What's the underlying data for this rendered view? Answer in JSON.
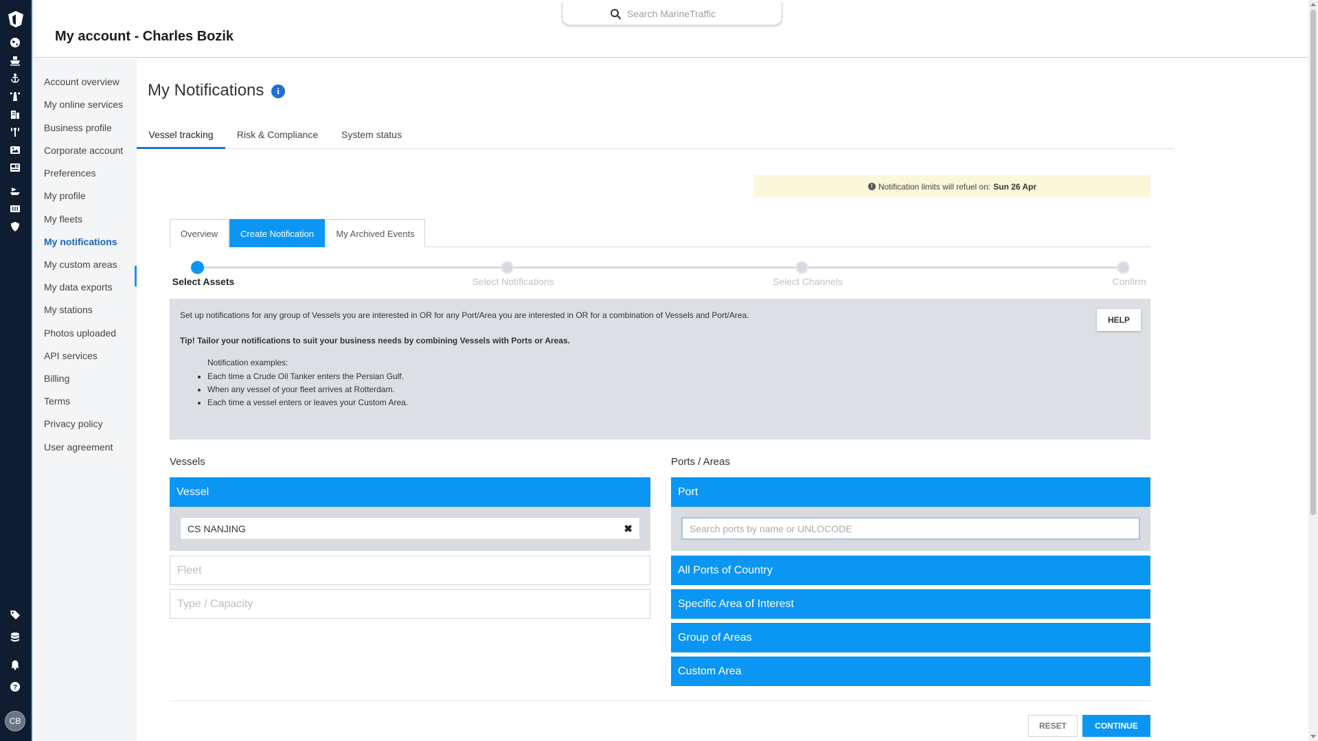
{
  "header": {
    "title": "My account - Charles Bozik",
    "search_placeholder": "Search MarineTraffic"
  },
  "user": {
    "initials": "CB"
  },
  "rail_icons": [
    "logo-icon",
    "globe-icon",
    "ship-icon",
    "anchor-icon",
    "lighthouse-icon",
    "buildings-icon",
    "antenna-icon",
    "photos-icon",
    "news-icon",
    "vessel-icon",
    "grid-icon",
    "shield-icon",
    "tag-icon",
    "database-icon",
    "bell-icon",
    "help-icon"
  ],
  "account_nav": {
    "items": [
      {
        "label": "Account overview"
      },
      {
        "label": "My online services"
      },
      {
        "label": "Business profile"
      },
      {
        "label": "Corporate account"
      },
      {
        "label": "Preferences"
      },
      {
        "label": "My profile"
      },
      {
        "label": "My fleets"
      },
      {
        "label": "My notifications"
      },
      {
        "label": "My custom areas"
      },
      {
        "label": "My data exports"
      },
      {
        "label": "My stations"
      },
      {
        "label": "Photos uploaded"
      },
      {
        "label": "API services"
      },
      {
        "label": "Billing"
      },
      {
        "label": "Terms"
      },
      {
        "label": "Privacy policy"
      },
      {
        "label": "User agreement"
      }
    ],
    "active": "My notifications"
  },
  "main": {
    "title": "My Notifications",
    "info_glyph": "i",
    "tabs": [
      {
        "label": "Vessel tracking"
      },
      {
        "label": "Risk & Compliance"
      },
      {
        "label": "System status"
      }
    ],
    "active_tab": "Vessel tracking",
    "refuel": {
      "text": "Notification limits will refuel on:",
      "date": "Sun 26 Apr"
    },
    "subtabs": [
      {
        "label": "Overview"
      },
      {
        "label": "Create Notification"
      },
      {
        "label": "My Archived Events"
      }
    ],
    "active_subtab": "Create Notification",
    "steps": [
      {
        "label": "Select Assets"
      },
      {
        "label": "Select Notifications"
      },
      {
        "label": "Select Channels"
      },
      {
        "label": "Confirm"
      }
    ],
    "active_step": "Select Assets",
    "info": {
      "intro": "Set up notifications for any group of Vessels you are interested in OR for any Port/Area you are interested in OR for a combination of Vessels and Port/Area.",
      "tip": "Tip! Tailor your notifications to suit your business needs by combining Vessels with Ports or Areas.",
      "examples_title": "Notification examples:",
      "examples": [
        "Each time a Crude Oil Tanker enters the Persian Gulf.",
        "When any vessel of your fleet arrives at Rotterdam.",
        "Each time a vessel enters or leaves your Custom Area."
      ],
      "help_label": "HELP"
    },
    "vessels": {
      "title": "Vessels",
      "vessel_label": "Vessel",
      "vessel_value": "CS NANJING",
      "clear_glyph": "✖",
      "fleet_label": "Fleet",
      "type_label": "Type / Capacity"
    },
    "ports": {
      "title": "Ports / Areas",
      "port_label": "Port",
      "port_placeholder": "Search ports by name or UNLOCODE",
      "options": [
        {
          "label": "All Ports of Country"
        },
        {
          "label": "Specific Area of Interest"
        },
        {
          "label": "Group of Areas"
        },
        {
          "label": "Custom Area"
        }
      ]
    },
    "actions": {
      "reset": "RESET",
      "continue": "CONTINUE"
    }
  },
  "colors": {
    "primary": "#0a96f2",
    "rail": "#0f1d30",
    "active_link": "#1565c0",
    "refuel_bg": "#fbf7da",
    "info_bg": "#dcdfe3"
  }
}
